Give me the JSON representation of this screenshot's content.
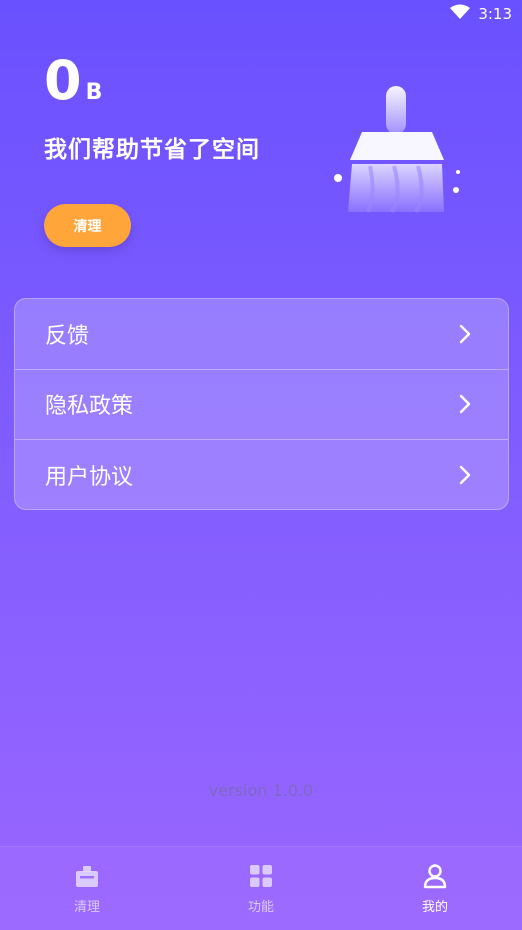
{
  "status_bar": {
    "time": "3:13",
    "wifi_icon": "wifi-icon"
  },
  "hero": {
    "saved_value": "0",
    "saved_unit": "B",
    "saved_label": "我们帮助节省了空间",
    "clean_button": "清理",
    "illustration": "broom-icon"
  },
  "menu": {
    "items": [
      {
        "label": "反馈",
        "icon": "chevron-right-icon"
      },
      {
        "label": "隐私政策",
        "icon": "chevron-right-icon"
      },
      {
        "label": "用户协议",
        "icon": "chevron-right-icon"
      }
    ]
  },
  "version": "version 1.0.0",
  "bottom_nav": {
    "items": [
      {
        "label": "清理",
        "icon": "clean-icon",
        "active": false
      },
      {
        "label": "功能",
        "icon": "grid-icon",
        "active": false
      },
      {
        "label": "我的",
        "icon": "profile-icon",
        "active": true
      }
    ]
  },
  "colors": {
    "accent": "#ffa53a",
    "background_top": "#6a51ff",
    "background_bottom": "#9a66ff"
  }
}
